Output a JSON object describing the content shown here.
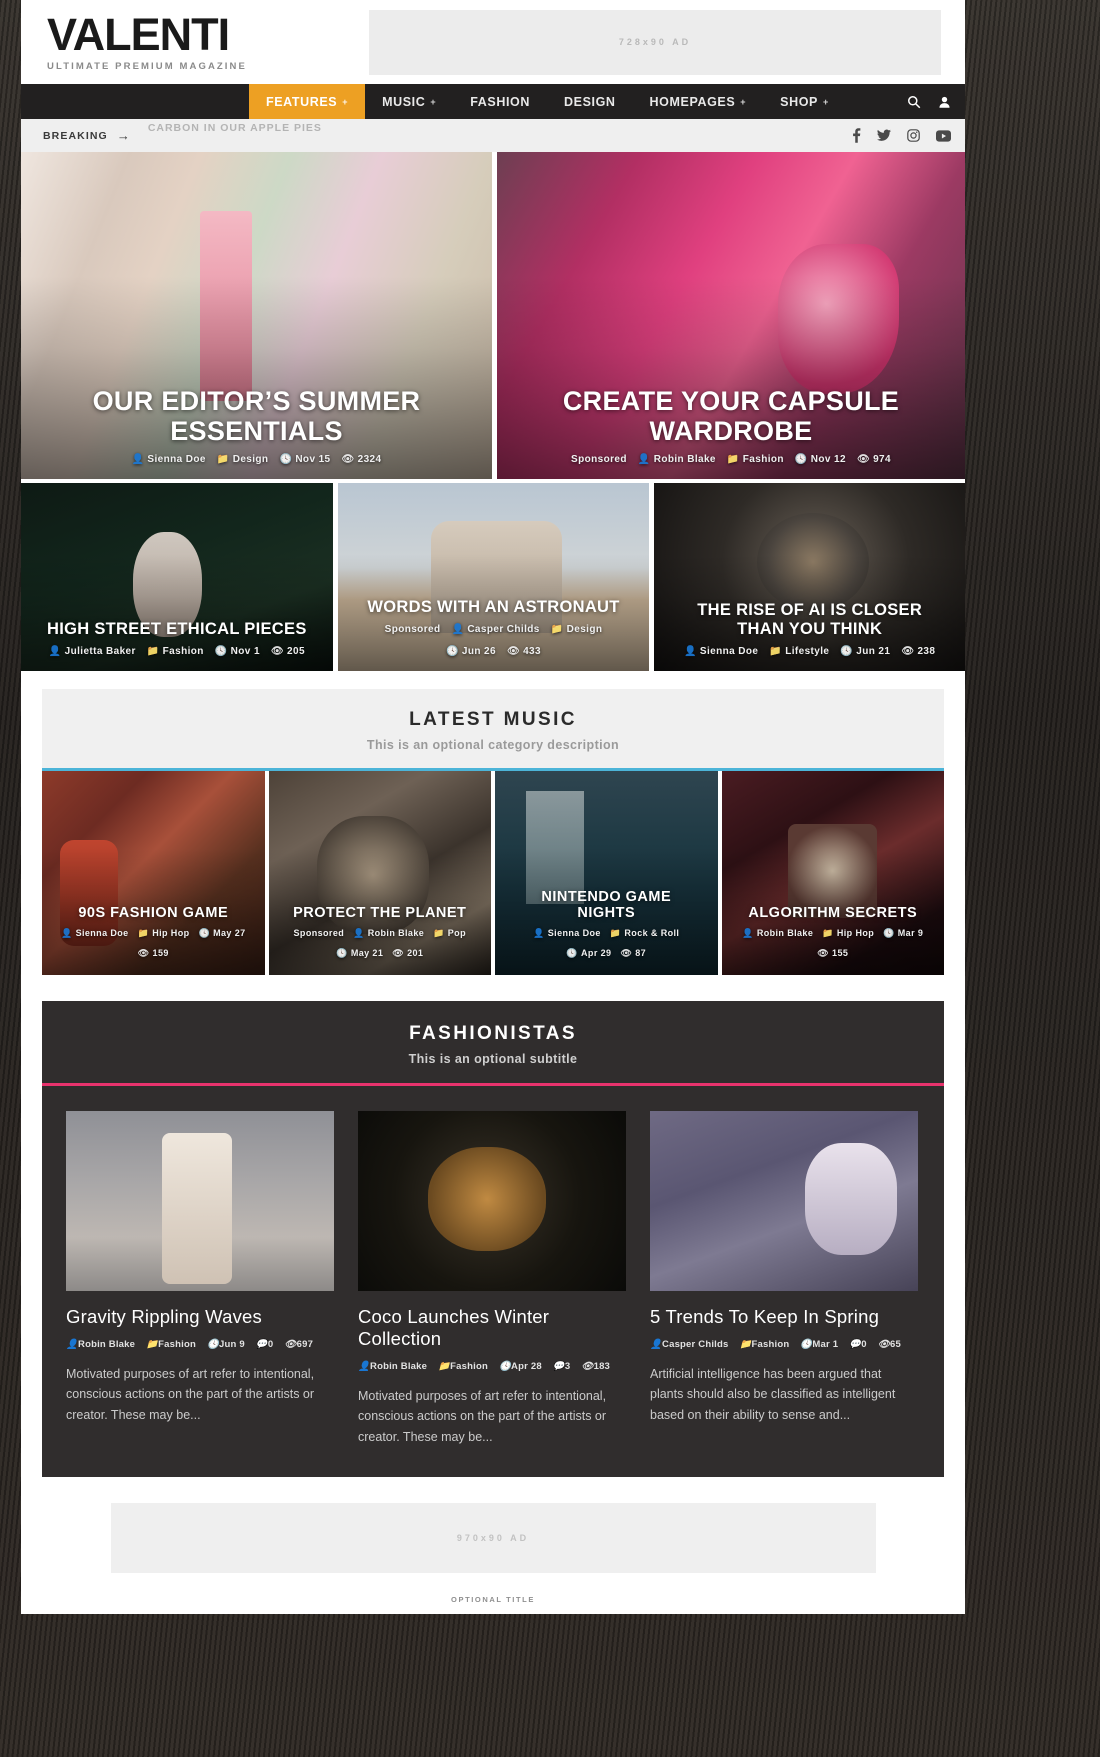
{
  "brand": {
    "name": "VALENTI",
    "tagline": "ULTIMATE PREMIUM MAGAZINE"
  },
  "header": {
    "ad_label": "728x90 AD"
  },
  "nav": {
    "items": [
      {
        "label": "FEATURES",
        "caret": "+",
        "active": true
      },
      {
        "label": "MUSIC",
        "caret": "+",
        "active": false
      },
      {
        "label": "FASHION",
        "caret": "",
        "active": false
      },
      {
        "label": "DESIGN",
        "caret": "",
        "active": false
      },
      {
        "label": "HOMEPAGES",
        "caret": "+",
        "active": false
      },
      {
        "label": "SHOP",
        "caret": "+",
        "active": false
      }
    ],
    "icons": [
      "search-icon",
      "user-icon"
    ]
  },
  "breaking": {
    "label": "BREAKING",
    "arrow": "→",
    "headline": "CARBON IN OUR APPLE PIES",
    "social": [
      "facebook-icon",
      "twitter-icon",
      "instagram-icon",
      "youtube-icon"
    ]
  },
  "hero": {
    "big": [
      {
        "title": "OUR EDITOR’S SUMMER ESSENTIALS",
        "sponsored": "",
        "author": "Sienna Doe",
        "category": "Design",
        "date": "Nov 15",
        "views": "2324"
      },
      {
        "title": "CREATE YOUR CAPSULE WARDROBE",
        "sponsored": "Sponsored",
        "author": "Robin Blake",
        "category": "Fashion",
        "date": "Nov 12",
        "views": "974"
      }
    ],
    "small": [
      {
        "title": "HIGH STREET ETHICAL PIECES",
        "sponsored": "",
        "author": "Julietta Baker",
        "category": "Fashion",
        "date": "Nov 1",
        "views": "205"
      },
      {
        "title": "WORDS WITH AN ASTRONAUT",
        "sponsored": "Sponsored",
        "author": "Casper Childs",
        "category": "Design",
        "date": "Jun 26",
        "views": "433"
      },
      {
        "title": "THE RISE OF AI IS CLOSER THAN YOU THINK",
        "sponsored": "",
        "author": "Sienna Doe",
        "category": "Lifestyle",
        "date": "Jun 21",
        "views": "238"
      }
    ]
  },
  "music_section": {
    "title": "LATEST MUSIC",
    "subtitle": "This is an optional category description",
    "accent": "#4cb4d8",
    "cards": [
      {
        "title": "90S FASHION GAME",
        "sponsored": "",
        "author": "Sienna Doe",
        "category": "Hip Hop",
        "date": "May 27",
        "views": "159"
      },
      {
        "title": "PROTECT THE PLANET",
        "sponsored": "Sponsored",
        "author": "Robin Blake",
        "category": "Pop",
        "date": "May 21",
        "views": "201"
      },
      {
        "title": "NINTENDO GAME NIGHTS",
        "sponsored": "",
        "author": "Sienna Doe",
        "category": "Rock & Roll",
        "date": "Apr 29",
        "views": "87"
      },
      {
        "title": "ALGORITHM SECRETS",
        "sponsored": "",
        "author": "Robin Blake",
        "category": "Hip Hop",
        "date": "Mar 9",
        "views": "155"
      }
    ]
  },
  "fashion_section": {
    "title": "FASHIONISTAS",
    "subtitle": "This is an optional subtitle",
    "accent": "#e8336d",
    "articles": [
      {
        "title": "Gravity Rippling Waves",
        "author": "Robin Blake",
        "category": "Fashion",
        "date": "Jun 9",
        "comments": "0",
        "views": "697",
        "excerpt": "Motivated purposes of art refer to intentional, conscious actions on the part of the artists or creator. These may be..."
      },
      {
        "title": "Coco Launches Winter Collection",
        "author": "Robin Blake",
        "category": "Fashion",
        "date": "Apr 28",
        "comments": "3",
        "views": "183",
        "excerpt": "Motivated purposes of art refer to intentional, conscious actions on the part of the artists or creator. These may be..."
      },
      {
        "title": "5 Trends To Keep In Spring",
        "author": "Casper Childs",
        "category": "Fashion",
        "date": "Mar 1",
        "comments": "0",
        "views": "65",
        "excerpt": "Artificial intelligence has been argued that plants should also be classified as intelligent based on their ability to sense and..."
      }
    ]
  },
  "footer_ad": {
    "label": "970x90 AD",
    "optional_title": "OPTIONAL TITLE"
  }
}
